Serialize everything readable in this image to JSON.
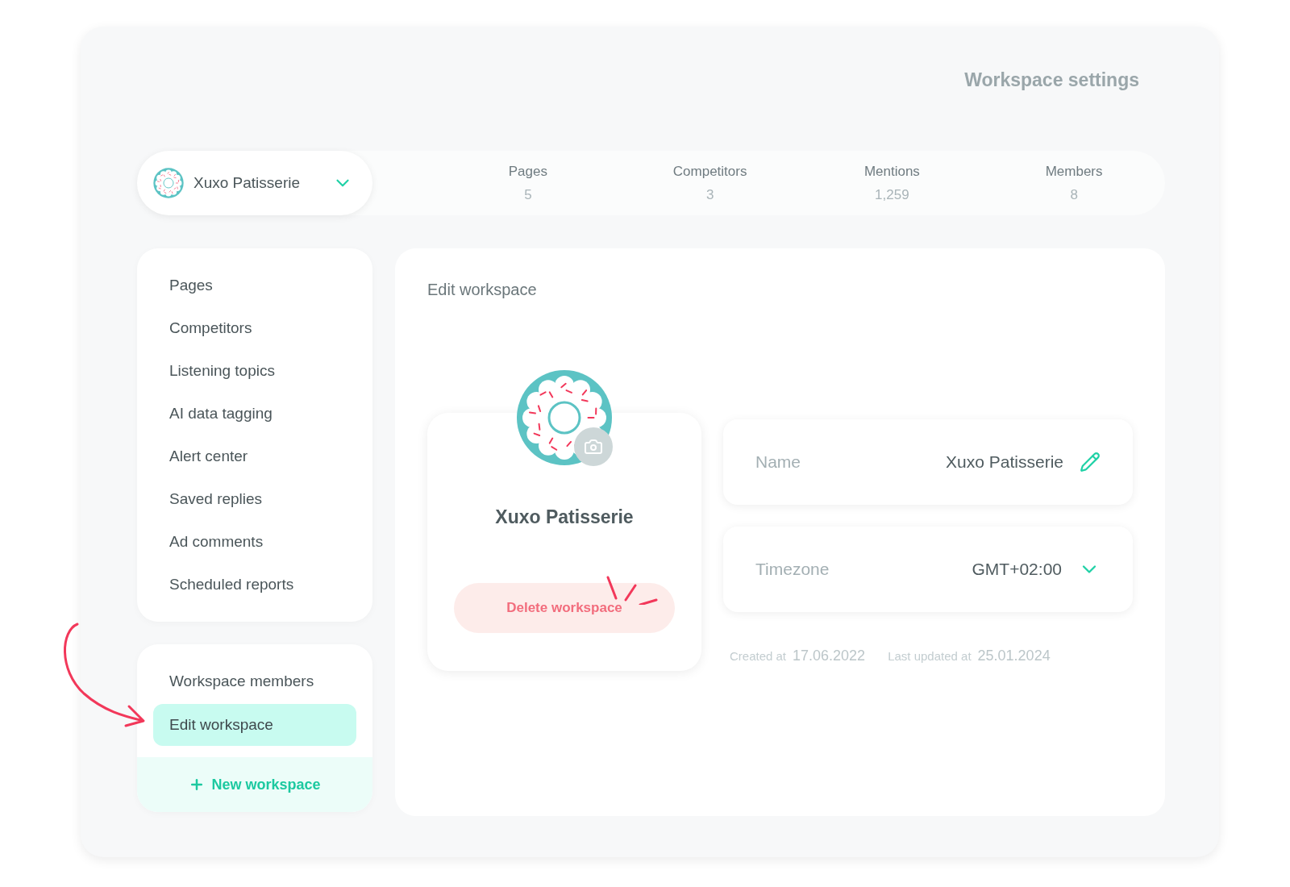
{
  "page": {
    "title": "Workspace settings"
  },
  "workspace_selector": {
    "name": "Xuxo Patisserie"
  },
  "stats": [
    {
      "label": "Pages",
      "value": "5"
    },
    {
      "label": "Competitors",
      "value": "3"
    },
    {
      "label": "Mentions",
      "value": "1,259"
    },
    {
      "label": "Members",
      "value": "8"
    }
  ],
  "sidebar": {
    "items": [
      {
        "label": "Pages",
        "selected": false
      },
      {
        "label": "Competitors",
        "selected": false
      },
      {
        "label": "Listening topics",
        "selected": false
      },
      {
        "label": "AI data tagging",
        "selected": false
      },
      {
        "label": "Alert center",
        "selected": false
      },
      {
        "label": "Saved replies",
        "selected": false
      },
      {
        "label": "Ad comments",
        "selected": false
      },
      {
        "label": "Scheduled reports",
        "selected": false
      }
    ]
  },
  "workspace_menu": {
    "items": [
      {
        "label": "Workspace members",
        "selected": false
      },
      {
        "label": "Edit workspace",
        "selected": true
      }
    ],
    "new_button": "New workspace"
  },
  "main": {
    "title": "Edit workspace",
    "avatar_card": {
      "name": "Xuxo Patisserie",
      "delete_button": "Delete workspace"
    },
    "fields": [
      {
        "kind": "text",
        "label": "Name",
        "value": "Xuxo Patisserie"
      },
      {
        "kind": "select",
        "label": "Timezone",
        "value": "GMT+02:00"
      }
    ],
    "meta": [
      {
        "label": "Created at",
        "value": "17.06.2022"
      },
      {
        "label": "Last updated at",
        "value": "25.01.2024"
      }
    ]
  }
}
